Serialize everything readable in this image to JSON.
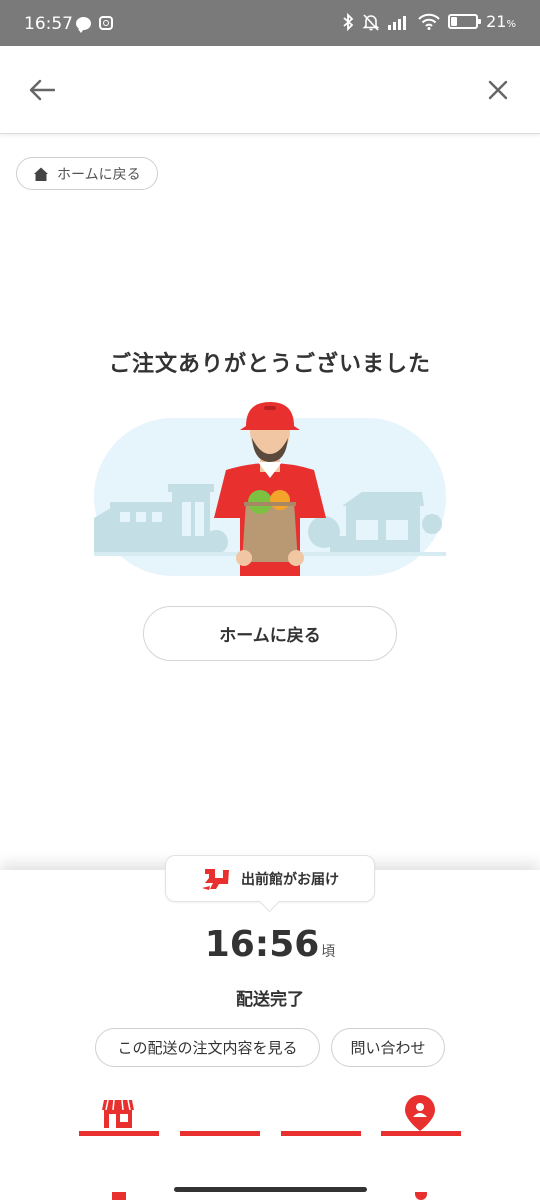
{
  "status_bar": {
    "time": "16:57",
    "battery_percent": "21",
    "battery_unit": "%",
    "left_icons": [
      "line-icon",
      "instagram-icon"
    ],
    "right_icons": [
      "bluetooth-icon",
      "bell-off-icon",
      "signal-icon",
      "wifi-icon",
      "battery-icon"
    ]
  },
  "header": {
    "back_icon": "arrow-left-icon",
    "close_icon": "close-icon"
  },
  "home_chip": {
    "label": "ホームに戻る",
    "icon": "home-icon"
  },
  "main": {
    "title": "ご注文ありがとうございました",
    "home_button_label": "ホームに戻る"
  },
  "delivery": {
    "provider_name": "出前館がお届け",
    "eta_time": "16:56",
    "eta_suffix": "頃",
    "status": "配送完了",
    "order_details_label": "この配送の注文内容を見る",
    "contact_label": "問い合わせ",
    "progress_steps_total": 4,
    "progress_steps_completed": 4,
    "step_icons": [
      "store-icon",
      "location-pin-icon"
    ]
  },
  "colors": {
    "accent": "#e8302f",
    "status_bar_bg": "#7a7a7a",
    "illustration_bg": "#e6f4fb",
    "buildings": "#c3dfe5"
  }
}
